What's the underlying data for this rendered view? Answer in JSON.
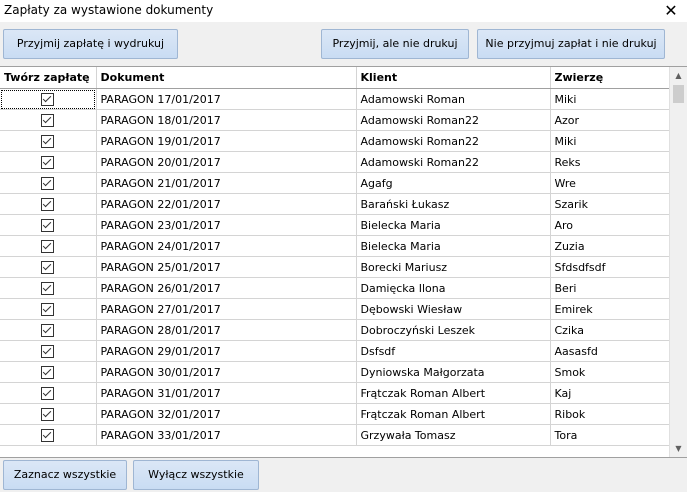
{
  "window": {
    "title": "Zapłaty za wystawione dokumenty"
  },
  "top_buttons": {
    "accept_print": "Przyjmij zapłatę i wydrukuj",
    "accept_no_print": "Przyjmij, ale nie drukuj",
    "reject": "Nie przyjmuj zapłat i nie drukuj"
  },
  "table": {
    "headers": [
      "Twórz zapłatę",
      "Dokument",
      "Klient",
      "Zwierzę"
    ],
    "rows": [
      {
        "checked": true,
        "doc": "PARAGON 17/01/2017",
        "client": "Adamowski Roman",
        "animal": "Miki"
      },
      {
        "checked": true,
        "doc": "PARAGON 18/01/2017",
        "client": "Adamowski Roman22",
        "animal": "Azor"
      },
      {
        "checked": true,
        "doc": "PARAGON 19/01/2017",
        "client": "Adamowski Roman22",
        "animal": "Miki"
      },
      {
        "checked": true,
        "doc": "PARAGON 20/01/2017",
        "client": "Adamowski Roman22",
        "animal": "Reks"
      },
      {
        "checked": true,
        "doc": "PARAGON 21/01/2017",
        "client": "Agafg",
        "animal": "Wre"
      },
      {
        "checked": true,
        "doc": "PARAGON 22/01/2017",
        "client": "Barański Łukasz",
        "animal": "Szarik"
      },
      {
        "checked": true,
        "doc": "PARAGON 23/01/2017",
        "client": "Bielecka Maria",
        "animal": "Aro"
      },
      {
        "checked": true,
        "doc": "PARAGON 24/01/2017",
        "client": "Bielecka Maria",
        "animal": "Zuzia"
      },
      {
        "checked": true,
        "doc": "PARAGON 25/01/2017",
        "client": "Borecki  Mariusz",
        "animal": "Sfdsdfsdf"
      },
      {
        "checked": true,
        "doc": "PARAGON 26/01/2017",
        "client": "Damięcka Ilona",
        "animal": "Beri"
      },
      {
        "checked": true,
        "doc": "PARAGON 27/01/2017",
        "client": "Dębowski Wiesław",
        "animal": "Emirek"
      },
      {
        "checked": true,
        "doc": "PARAGON 28/01/2017",
        "client": "Dobroczyński Leszek",
        "animal": "Czika"
      },
      {
        "checked": true,
        "doc": "PARAGON 29/01/2017",
        "client": "Dsfsdf",
        "animal": "Aasasfd"
      },
      {
        "checked": true,
        "doc": "PARAGON 30/01/2017",
        "client": "Dyniowska Małgorzata",
        "animal": "Smok"
      },
      {
        "checked": true,
        "doc": "PARAGON 31/01/2017",
        "client": "Frątczak Roman Albert",
        "animal": "Kaj"
      },
      {
        "checked": true,
        "doc": "PARAGON 32/01/2017",
        "client": "Frątczak Roman Albert",
        "animal": "Ribok"
      },
      {
        "checked": true,
        "doc": "PARAGON 33/01/2017",
        "client": "Grzywała Tomasz",
        "animal": "Tora"
      }
    ]
  },
  "bottom_buttons": {
    "select_all": "Zaznacz wszystkie",
    "deselect_all": "Wyłącz wszystkie"
  }
}
